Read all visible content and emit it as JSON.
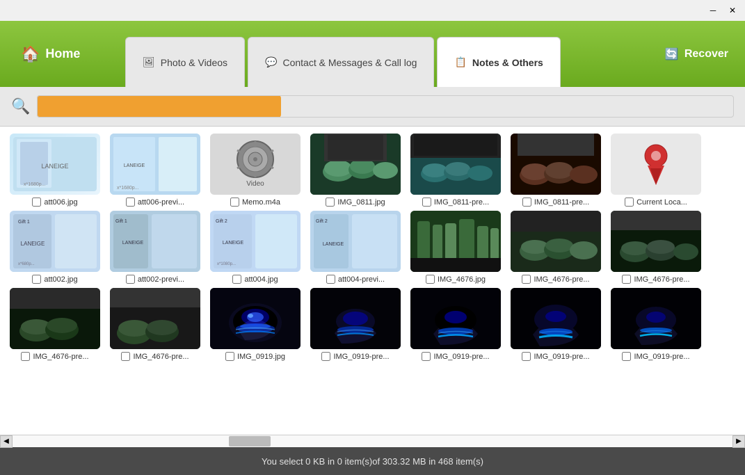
{
  "titlebar": {
    "minimize_label": "─",
    "close_label": "✕"
  },
  "header": {
    "home_label": "Home",
    "tabs": [
      {
        "id": "photo",
        "label": "Photo & Videos",
        "icon": "photo-icon",
        "active": false
      },
      {
        "id": "contact",
        "label": "Contact & Messages & Call log",
        "icon": "message-icon",
        "active": false
      },
      {
        "id": "notes",
        "label": "Notes & Others",
        "icon": "notes-icon",
        "active": true
      }
    ],
    "recover_label": "Recover",
    "recover_icon": "recover-icon"
  },
  "search": {
    "placeholder": "",
    "progress_visible": true
  },
  "files": {
    "rows": [
      [
        {
          "id": 1,
          "name": "att006.jpg",
          "type": "laneige",
          "checked": false
        },
        {
          "id": 2,
          "name": "att006-previ...",
          "type": "laneige2",
          "checked": false
        },
        {
          "id": 3,
          "name": "Memo.m4a",
          "type": "video",
          "checked": false
        },
        {
          "id": 4,
          "name": "IMG_0811.jpg",
          "type": "bowl-green",
          "checked": false
        },
        {
          "id": 5,
          "name": "IMG_0811-pre...",
          "type": "bowl-teal",
          "checked": false
        },
        {
          "id": 6,
          "name": "IMG_0811-pre...",
          "type": "bowl-dark",
          "checked": false
        },
        {
          "id": 7,
          "name": "Current Loca...",
          "type": "pin",
          "checked": false
        }
      ],
      [
        {
          "id": 8,
          "name": "att002.jpg",
          "type": "laneige3",
          "checked": false
        },
        {
          "id": 9,
          "name": "att002-previ...",
          "type": "laneige4",
          "checked": false
        },
        {
          "id": 10,
          "name": "att004.jpg",
          "type": "laneige5",
          "checked": false
        },
        {
          "id": 11,
          "name": "att004-previ...",
          "type": "laneige6",
          "checked": false
        },
        {
          "id": 12,
          "name": "IMG_4676.jpg",
          "type": "bottles",
          "checked": false
        },
        {
          "id": 13,
          "name": "IMG_4676-pre...",
          "type": "cups2",
          "checked": false
        },
        {
          "id": 14,
          "name": "IMG_4676-pre...",
          "type": "cups3",
          "checked": false
        }
      ],
      [
        {
          "id": 15,
          "name": "IMG_4676-pre...",
          "type": "cups4",
          "checked": false
        },
        {
          "id": 16,
          "name": "IMG_4676-pre...",
          "type": "cups5",
          "checked": false
        },
        {
          "id": 17,
          "name": "IMG_0919.jpg",
          "type": "mouse1",
          "checked": false
        },
        {
          "id": 18,
          "name": "IMG_0919-pre...",
          "type": "mouse2",
          "checked": false
        },
        {
          "id": 19,
          "name": "IMG_0919-pre...",
          "type": "mouse3",
          "checked": false
        },
        {
          "id": 20,
          "name": "IMG_0919-pre...",
          "type": "mouse4",
          "checked": false
        },
        {
          "id": 21,
          "name": "IMG_0919-pre...",
          "type": "mouse5",
          "checked": false
        }
      ]
    ]
  },
  "status_bar": {
    "text": "You select 0 KB in 0 item(s)of 303.32 MB in 468 item(s)"
  }
}
